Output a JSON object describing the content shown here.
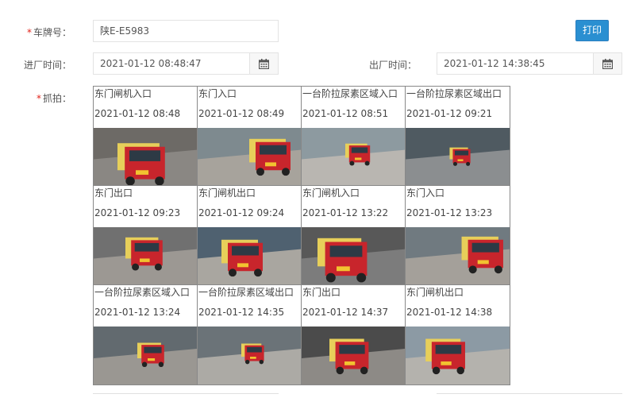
{
  "form": {
    "plate": {
      "required_mark": "*",
      "label": "车牌号：",
      "value": "陕E-E5983"
    },
    "entry_time": {
      "label": "进厂时间：",
      "value": "2021-01-12 08:48:47",
      "icon": "calendar-icon"
    },
    "exit_time": {
      "label": "出厂时间：",
      "value": "2021-01-12 14:38:45",
      "icon": "calendar-icon"
    },
    "snapshot": {
      "required_mark": "*",
      "label": "抓拍："
    },
    "print_label": "打印"
  },
  "snapshots": [
    {
      "location": "东门闸机入口",
      "time": "2021-01-12 08:48"
    },
    {
      "location": "东门入口",
      "time": "2021-01-12 08:49"
    },
    {
      "location": "一台阶拉尿素区域入口",
      "time": "2021-01-12 08:51"
    },
    {
      "location": "一台阶拉尿素区域出口",
      "time": "2021-01-12 09:21"
    },
    {
      "location": "东门出口",
      "time": "2021-01-12 09:23"
    },
    {
      "location": "东门闸机出口",
      "time": "2021-01-12 09:24"
    },
    {
      "location": "东门闸机入口",
      "time": "2021-01-12 13:22"
    },
    {
      "location": "东门入口",
      "time": "2021-01-12 13:23"
    },
    {
      "location": "一台阶拉尿素区域入口",
      "time": "2021-01-12 13:24"
    },
    {
      "location": "一台阶拉尿素区域出口",
      "time": "2021-01-12 14:35"
    },
    {
      "location": "东门出口",
      "time": "2021-01-12 14:37"
    },
    {
      "location": "东门闸机出口",
      "time": "2021-01-12 14:38"
    }
  ],
  "colors": {
    "accent": "#2a8fd1",
    "required": "#e2231a",
    "truck": "#c8252c"
  }
}
